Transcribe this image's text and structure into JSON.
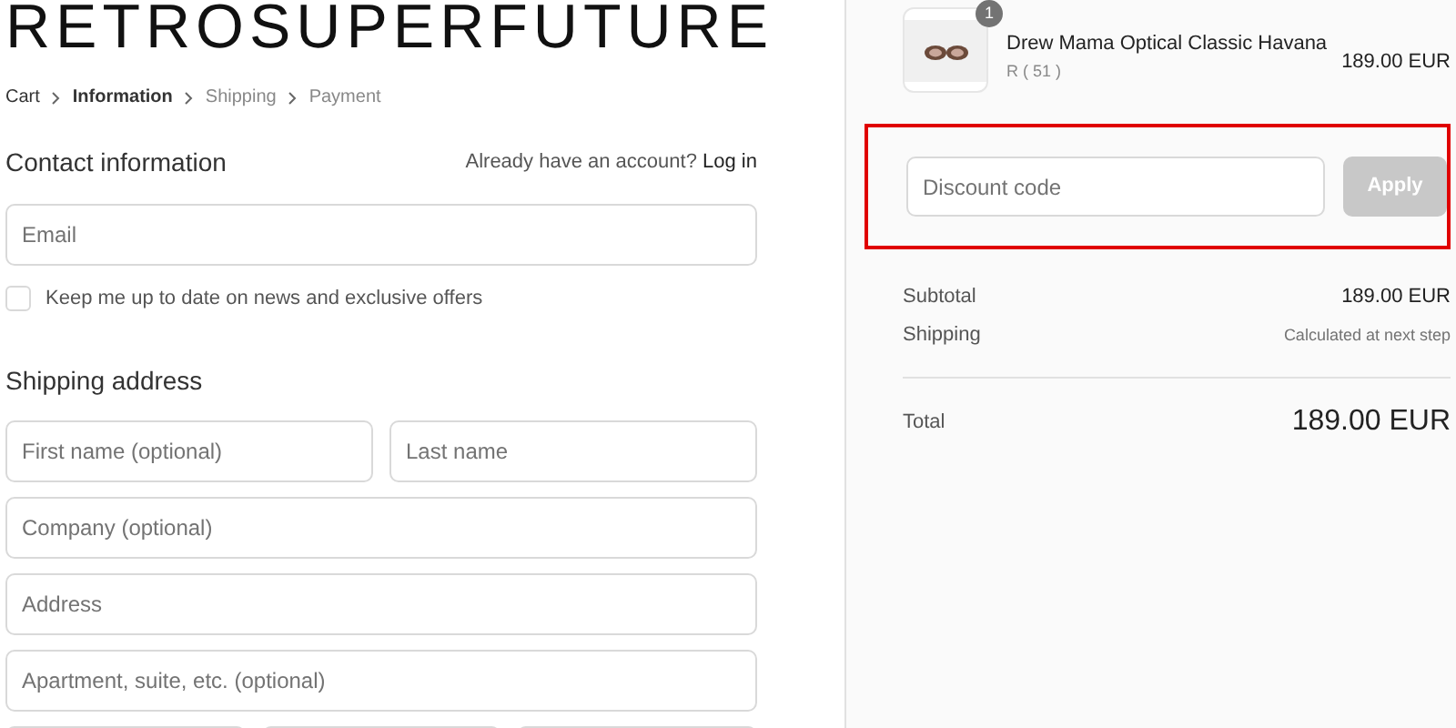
{
  "logo": "RETROSUPERFUTURE",
  "breadcrumb": [
    {
      "label": "Cart",
      "kind": "done"
    },
    {
      "label": "Information",
      "kind": "current"
    },
    {
      "label": "Shipping",
      "kind": "upcoming"
    },
    {
      "label": "Payment",
      "kind": "upcoming"
    }
  ],
  "contact": {
    "heading": "Contact information",
    "account_prompt": "Already have an account?",
    "login_link": "Log in",
    "email": {
      "placeholder": "Email"
    },
    "newsletter": {
      "label": "Keep me up to date on news and exclusive offers",
      "checked": false
    }
  },
  "shipping": {
    "heading": "Shipping address",
    "rows": [
      [
        {
          "placeholder": "First name (optional)"
        },
        {
          "placeholder": "Last name"
        }
      ],
      [
        {
          "placeholder": "Company (optional)"
        }
      ],
      [
        {
          "placeholder": "Address"
        }
      ],
      [
        {
          "placeholder": "Apartment, suite, etc. (optional)"
        }
      ]
    ]
  },
  "order": {
    "item": {
      "quantity": "1",
      "name": "Drew Mama Optical Classic Havana",
      "variant": "R ( 51 )",
      "price": "189.00 EUR"
    },
    "discount": {
      "placeholder": "Discount code",
      "button": "Apply",
      "highlighted": true
    },
    "subtotal": {
      "label": "Subtotal",
      "value": "189.00 EUR"
    },
    "shipping": {
      "label": "Shipping",
      "value": "Calculated at next step"
    },
    "total": {
      "label": "Total",
      "value": "189.00 EUR"
    }
  }
}
